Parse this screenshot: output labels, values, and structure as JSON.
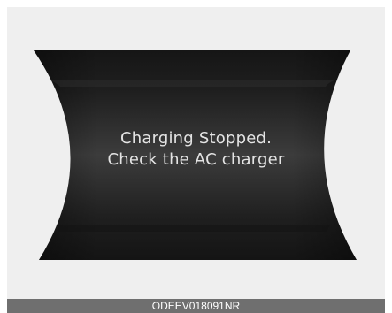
{
  "display": {
    "message_line1": "Charging Stopped.",
    "message_line2": "Check the AC charger"
  },
  "caption": {
    "code": "ODEEV018091NR"
  },
  "colors": {
    "background": "#efefef",
    "panel_dark": "#1d1d1d",
    "panel_mid": "#3a3a3a",
    "text": "#e4e4e4",
    "caption_bar": "#6f6f6f"
  }
}
